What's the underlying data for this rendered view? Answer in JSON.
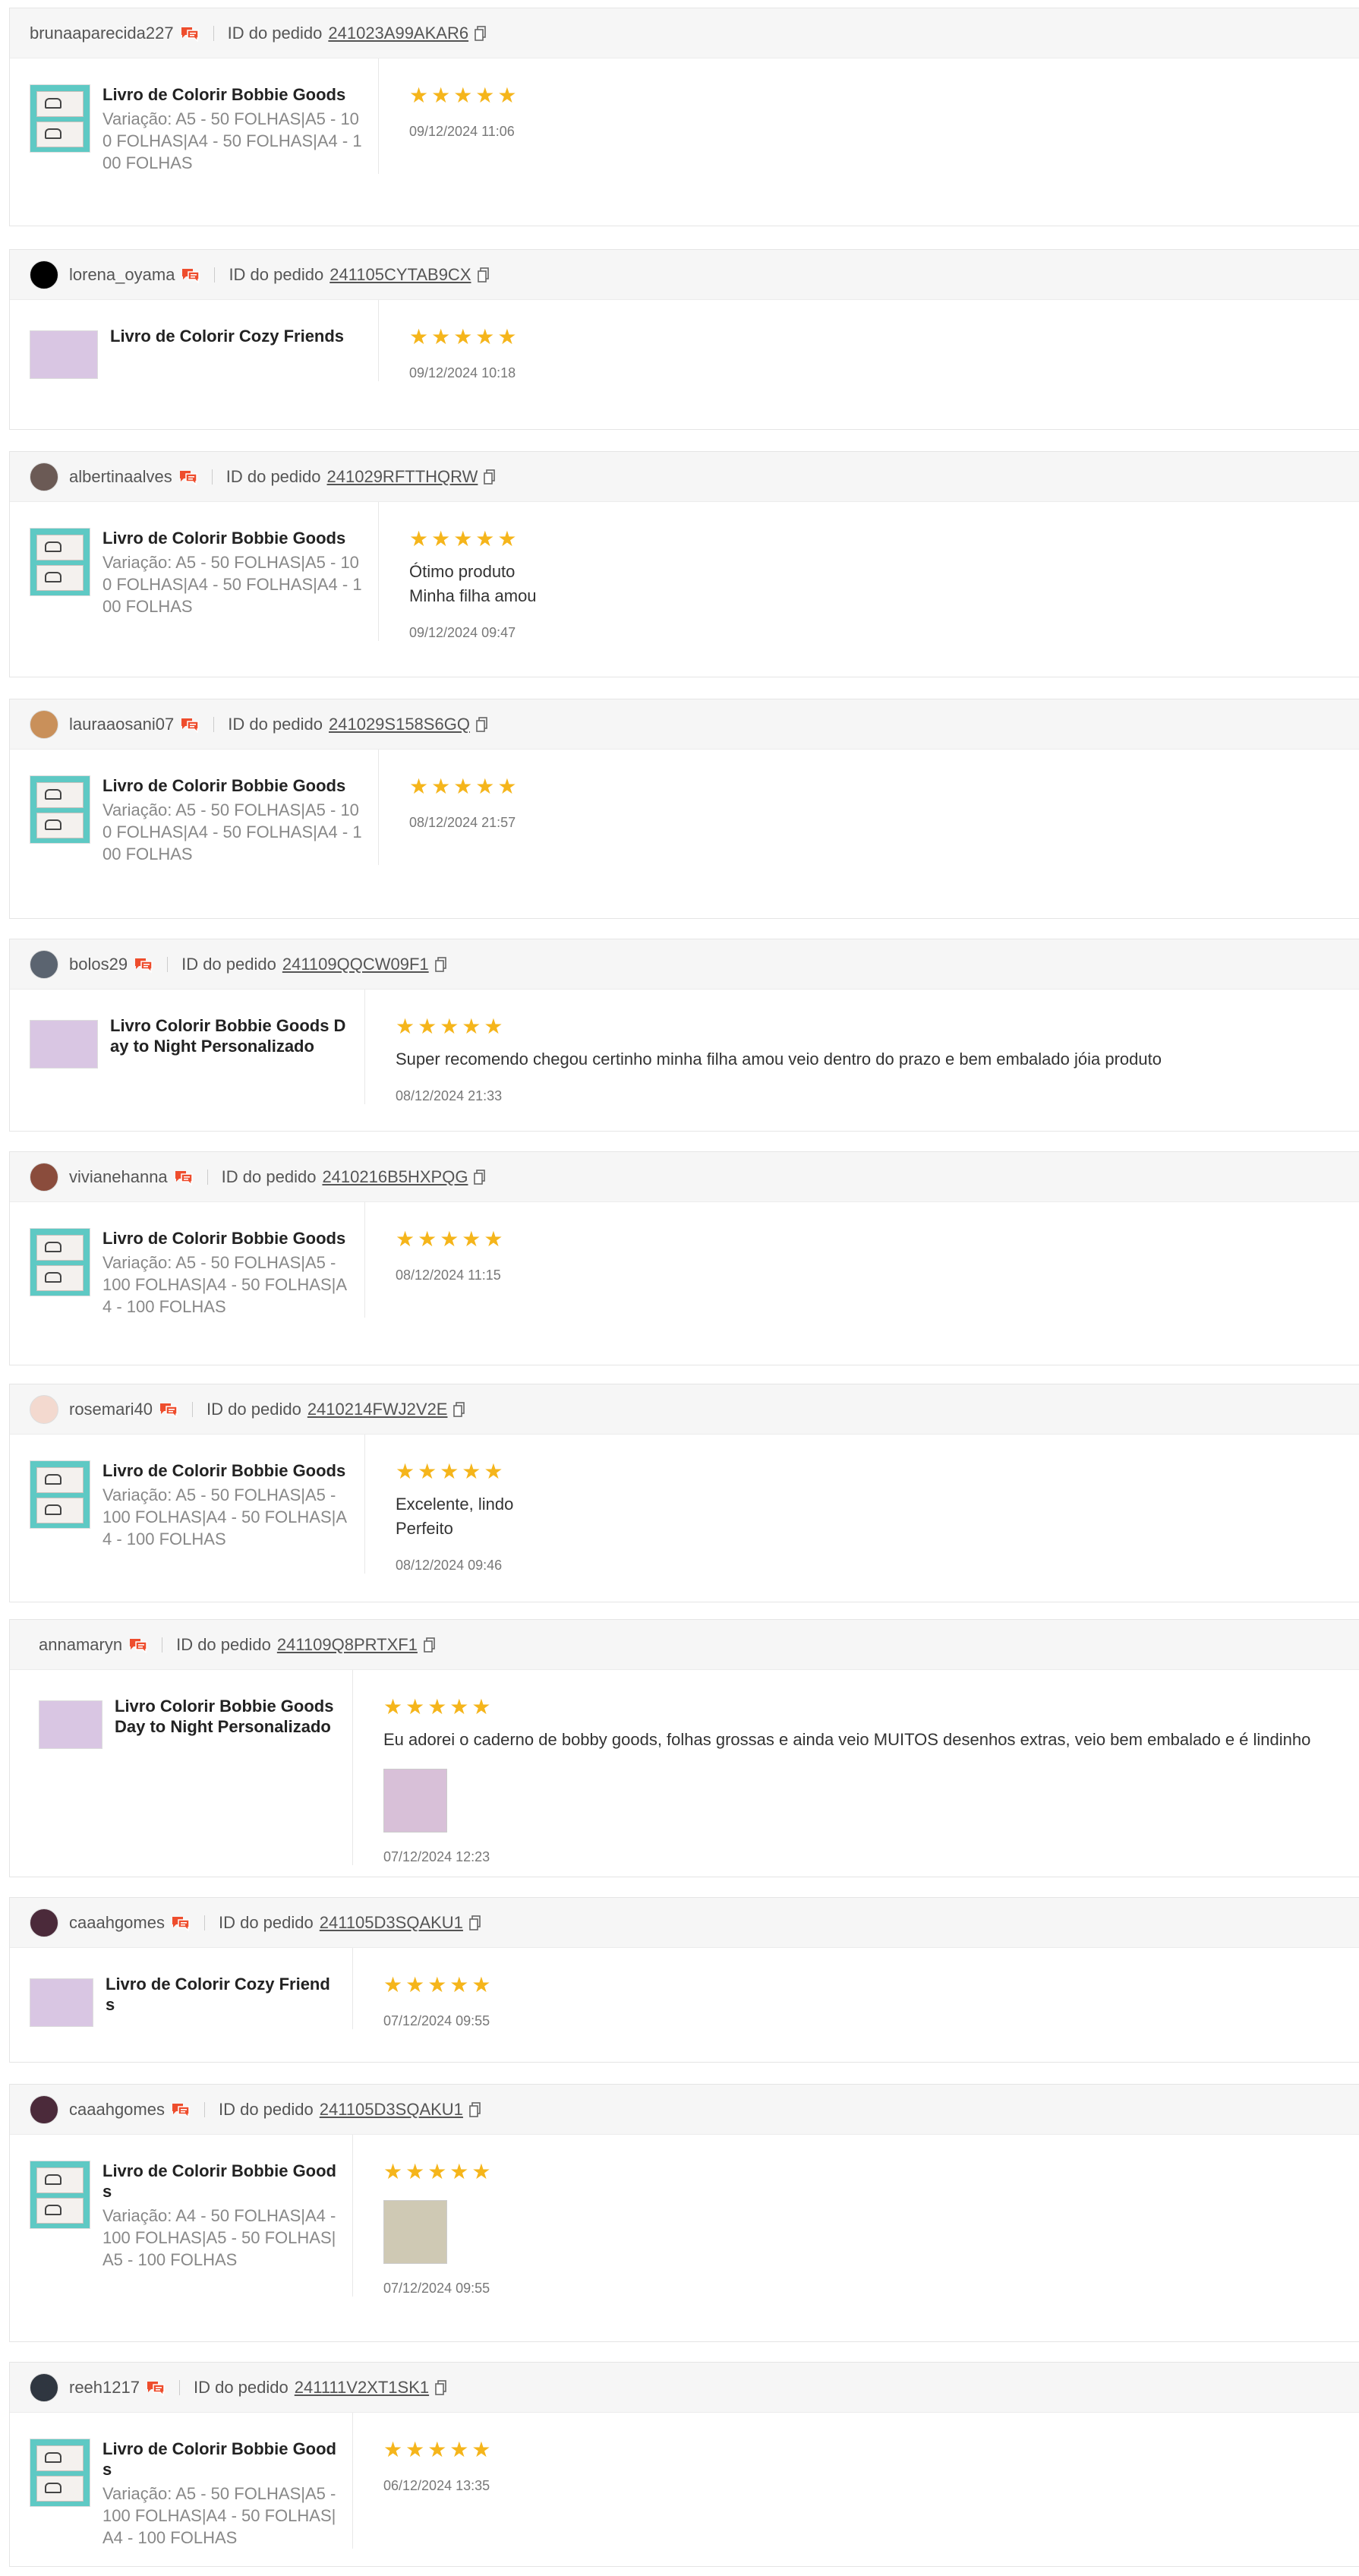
{
  "order_label": "ID do pedido",
  "stars_glyph": "★★★★★",
  "reviews": [
    {
      "user": "brunaaparecida227",
      "order_id": "241023A99AKAR6",
      "product_name": "Livro de Colorir Bobbie Goods",
      "variation": "Variação: A5 - 50 FOLHAS|A5 - 100 FOLHAS|A4 - 50 FOLHAS|A4 - 100 FOLHAS",
      "rating": 5,
      "text": "",
      "date": "09/12/2024 11:06"
    },
    {
      "user": "lorena_oyama",
      "order_id": "241105CYTAB9CX",
      "product_name": "Livro de Colorir Cozy Friends",
      "variation": "",
      "rating": 5,
      "text": "",
      "date": "09/12/2024 10:18"
    },
    {
      "user": "albertinaalves",
      "order_id": "241029RFTTHQRW",
      "product_name": "Livro de Colorir Bobbie Goods",
      "variation": "Variação: A5 - 50 FOLHAS|A5 - 100 FOLHAS|A4 - 50 FOLHAS|A4 - 100 FOLHAS",
      "rating": 5,
      "text": "Ótimo produto\nMinha filha amou",
      "date": "09/12/2024 09:47"
    },
    {
      "user": "lauraaosani07",
      "order_id": "241029S158S6GQ",
      "product_name": "Livro de Colorir Bobbie Goods",
      "variation": "Variação: A5 - 50 FOLHAS|A5 - 100 FOLHAS|A4 - 50 FOLHAS|A4 - 100 FOLHAS",
      "rating": 5,
      "text": "",
      "date": "08/12/2024 21:57"
    },
    {
      "user": "bolos29",
      "order_id": "241109QQCW09F1",
      "product_name": "Livro Colorir Bobbie Goods Day to Night Personalizado",
      "variation": "",
      "rating": 5,
      "text": "Super recomendo chegou certinho minha filha amou veio dentro do prazo e bem embalado jóia produto",
      "date": "08/12/2024 21:33"
    },
    {
      "user": "vivianehanna",
      "order_id": "2410216B5HXPQG",
      "product_name": "Livro de Colorir Bobbie Goods",
      "variation": "Variação: A5 - 50 FOLHAS|A5 - 100 FOLHAS|A4 - 50 FOLHAS|A4 - 100 FOLHAS",
      "rating": 5,
      "text": "",
      "date": "08/12/2024 11:15"
    },
    {
      "user": "rosemari40",
      "order_id": "2410214FWJ2V2E",
      "product_name": "Livro de Colorir Bobbie Goods",
      "variation": "Variação: A5 - 50 FOLHAS|A5 - 100 FOLHAS|A4 - 50 FOLHAS|A4 - 100 FOLHAS",
      "rating": 5,
      "text": "Excelente, lindo\nPerfeito",
      "date": "08/12/2024 09:46"
    },
    {
      "user": "annamaryn",
      "order_id": "241109Q8PRTXF1",
      "product_name": "Livro Colorir Bobbie Goods Day to Night Personalizado",
      "variation": "",
      "rating": 5,
      "text": "Eu adorei o caderno de bobby goods, folhas grossas e ainda veio MUITOS desenhos extras, veio bem embalado e é lindinho",
      "date": "07/12/2024 12:23"
    },
    {
      "user": "caaahgomes",
      "order_id": "241105D3SQAKU1",
      "product_name": "Livro de Colorir Cozy Friends",
      "variation": "",
      "rating": 5,
      "text": "",
      "date": "07/12/2024 09:55"
    },
    {
      "user": "caaahgomes",
      "order_id": "241105D3SQAKU1",
      "product_name": "Livro de Colorir Bobbie Goods",
      "variation": "Variação: A4 - 50 FOLHAS|A4 - 100 FOLHAS|A5 - 50 FOLHAS|A5 - 100 FOLHAS",
      "rating": 5,
      "text": "",
      "date": "07/12/2024 09:55"
    },
    {
      "user": "reeh1217",
      "order_id": "241111V2XT1SK1",
      "product_name": "Livro de Colorir Bobbie Goods",
      "variation": "Variação: A5 - 50 FOLHAS|A5 - 100 FOLHAS|A4 - 50 FOLHAS|A4 - 100 FOLHAS",
      "rating": 5,
      "text": "",
      "date": "06/12/2024 13:35"
    }
  ],
  "colors": {
    "star": "#f5b51b",
    "chat_icon": "#ee4d2d",
    "header_bg": "#f6f6f6"
  }
}
